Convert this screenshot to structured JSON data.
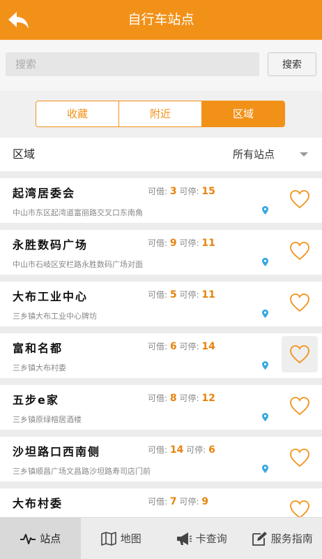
{
  "header": {
    "title": "自行车站点"
  },
  "search": {
    "placeholder": "搜索",
    "button": "搜索"
  },
  "tabs": [
    {
      "label": "收藏",
      "active": false
    },
    {
      "label": "附近",
      "active": false
    },
    {
      "label": "区域",
      "active": true
    }
  ],
  "filter": {
    "label": "区域",
    "selected": "所有站点"
  },
  "counts_labels": {
    "borrow": "可借:",
    "park": "可停:"
  },
  "stations": [
    {
      "name": "起湾居委会",
      "borrow": "3",
      "park": "15",
      "address": "中山市东区起湾道富丽路交叉口东南角"
    },
    {
      "name": "永胜数码广场",
      "borrow": "9",
      "park": "11",
      "address": "中山市石岐区安栏路永胜数码广场对面"
    },
    {
      "name": "大布工业中心",
      "borrow": "5",
      "park": "11",
      "address": "三乡镇大布工业中心牌坊"
    },
    {
      "name": "富和名都",
      "borrow": "6",
      "park": "14",
      "address": "三乡镇大布村委"
    },
    {
      "name": "五步e家",
      "borrow": "8",
      "park": "12",
      "address": "三乡镇原绿榕居酒楼"
    },
    {
      "name": "沙坦路口西南侧",
      "borrow": "14",
      "park": "6",
      "address": "三乡镇顺昌广场文昌路沙坦路寿司店门前"
    },
    {
      "name": "大布村委",
      "borrow": "7",
      "park": "9",
      "address": ""
    }
  ],
  "bottom_nav": [
    {
      "label": "站点",
      "icon": "pulse-icon",
      "active": true
    },
    {
      "label": "地图",
      "icon": "map-icon",
      "active": false
    },
    {
      "label": "卡查询",
      "icon": "megaphone-icon",
      "active": false
    },
    {
      "label": "服务指南",
      "icon": "edit-icon",
      "active": false
    }
  ],
  "colors": {
    "accent": "#f29118",
    "count": "#e8830c",
    "pin": "#35a8e0"
  }
}
